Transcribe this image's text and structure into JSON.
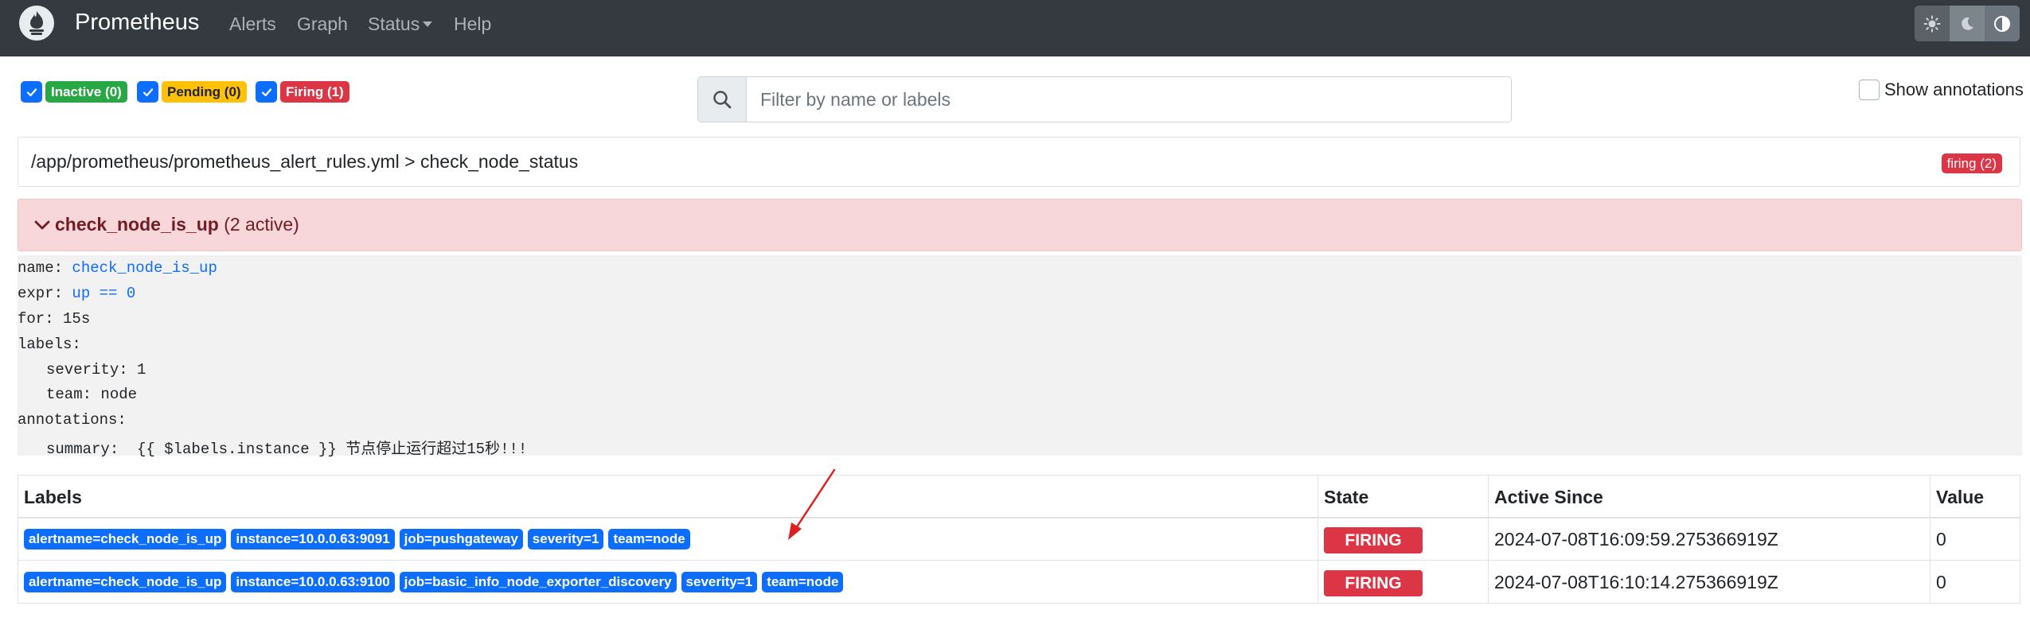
{
  "navbar": {
    "brand": "Prometheus",
    "items": [
      {
        "label": "Alerts"
      },
      {
        "label": "Graph"
      },
      {
        "label": "Status"
      },
      {
        "label": "Help"
      }
    ],
    "theme_icons": [
      "sun-icon",
      "moon-icon",
      "half-circle-icon"
    ]
  },
  "filters": {
    "inactive": "Inactive (0)",
    "pending": "Pending (0)",
    "firing": "Firing (1)"
  },
  "search": {
    "placeholder": "Filter by name or labels",
    "value": ""
  },
  "show_annotations": {
    "label": "Show annotations",
    "checked": false
  },
  "group": {
    "path": "/app/prometheus/prometheus_alert_rules.yml > check_node_status",
    "badge": "firing (2)"
  },
  "rule": {
    "name": "check_node_is_up",
    "active": "(2 active)",
    "def": {
      "name_key": "name:",
      "name_val": "check_node_is_up",
      "expr_key": "expr:",
      "expr_val": "up == 0",
      "for_line": "for: 15s",
      "labels_key": "labels:",
      "severity_line": "severity: 1",
      "team_line": "team: node",
      "annotations_key": "annotations:",
      "summary_line": "summary:  {{ $labels.instance }} 节点停止运行超过15秒!!!"
    }
  },
  "table": {
    "headers": {
      "labels": "Labels",
      "state": "State",
      "since": "Active Since",
      "value": "Value"
    },
    "rows": [
      {
        "labels": [
          "alertname=check_node_is_up",
          "instance=10.0.0.63:9091",
          "job=pushgateway",
          "severity=1",
          "team=node"
        ],
        "state": "FIRING",
        "since": "2024-07-08T16:09:59.275366919Z",
        "value": "0"
      },
      {
        "labels": [
          "alertname=check_node_is_up",
          "instance=10.0.0.63:9100",
          "job=basic_info_node_exporter_discovery",
          "severity=1",
          "team=node"
        ],
        "state": "FIRING",
        "since": "2024-07-08T16:10:14.275366919Z",
        "value": "0"
      }
    ]
  },
  "colors": {
    "navbar": "#343a40",
    "primary": "#0d6efd",
    "danger": "#dc3545",
    "success": "#28a745",
    "warning": "#ffc107",
    "rule_header_bg": "#f8d7da"
  }
}
